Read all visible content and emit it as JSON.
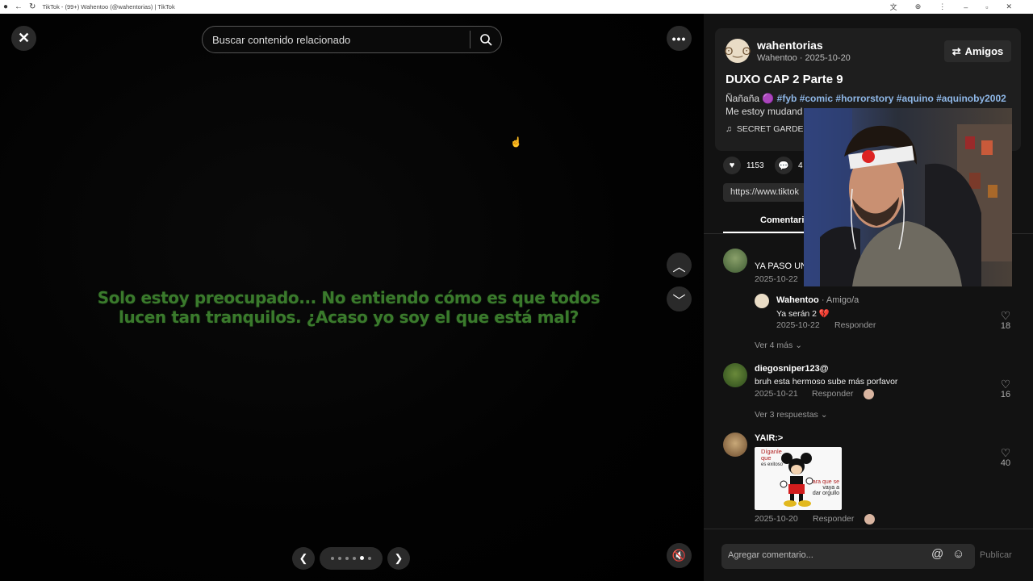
{
  "browser": {
    "window_title": "TikTok - (99+) Wahentoo (@wahentorias) | TikTok"
  },
  "video": {
    "search_placeholder": "Buscar contenido relacionado",
    "subtitle": "Solo estoy preocupado... No entiendo cómo es que todos lucen tan tranquilos. ¿Acaso yo soy el que está mal?"
  },
  "post": {
    "author_handle": "wahentorias",
    "author_name": "Wahentoo",
    "date": "2025-10-20",
    "friends_label": "Amigos",
    "title": "DUXO CAP 2 Parte 9",
    "desc_prefix": "Ñañaña",
    "hashtags": [
      "#fyb",
      "#comic",
      "#horrorstory",
      "#aquino",
      "#aquinoby2002"
    ],
    "desc_line2": "Me estoy mudand",
    "music": "SECRET GARDEN",
    "likes": "1153",
    "comments_count": "4",
    "url": "https://www.tiktok",
    "comments_tab": "Comentari"
  },
  "comments": [
    {
      "name": "YA PASO UN",
      "date": "2025-10-22",
      "reply": {
        "name": "Wahentoo",
        "badge": "· Amigo/a",
        "text": "Ya serán 2 💔",
        "date": "2025-10-22",
        "reply_label": "Responder",
        "likes": "18"
      },
      "more": "Ver 4 más"
    },
    {
      "name": "diegosniper123@",
      "text": "bruh esta hermoso sube más porfavor",
      "date": "2025-10-21",
      "reply_label": "Responder",
      "likes": "16",
      "more": "Ver 3 respuestas"
    },
    {
      "name": "YAIR:>",
      "date": "2025-10-20",
      "reply_label": "Responder",
      "likes": "40",
      "meme": {
        "line1": "Díganle",
        "line2": "que",
        "line3": "es exitoso",
        "line4": "Para que se",
        "line5": "vaya a",
        "line6": "dar orgullo"
      }
    }
  ],
  "input": {
    "placeholder": "Agregar comentario...",
    "publish": "Publicar"
  }
}
